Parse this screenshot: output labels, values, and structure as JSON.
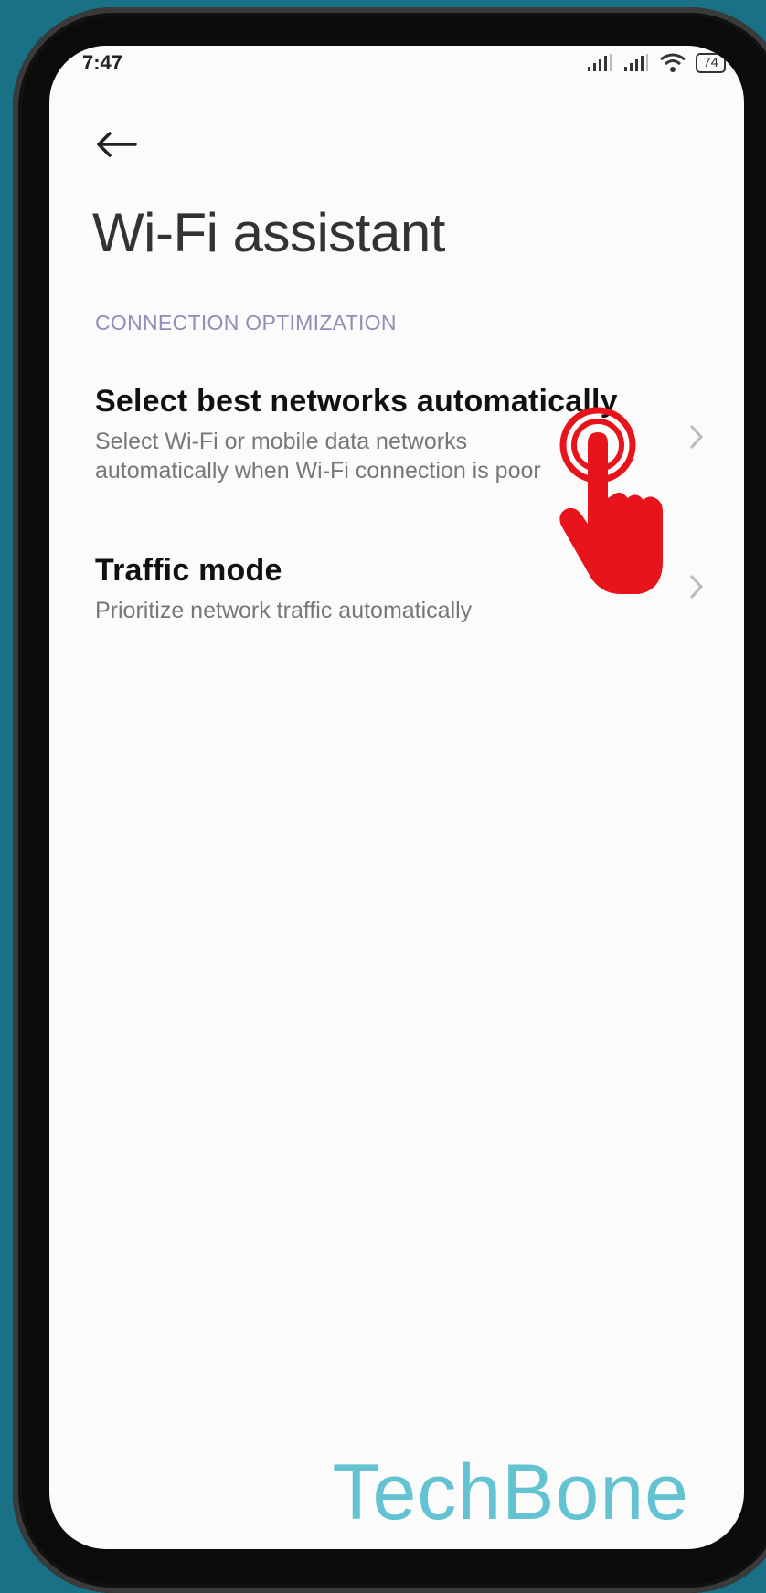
{
  "status": {
    "time": "7:47",
    "battery": "74"
  },
  "header": {
    "title": "Wi-Fi assistant"
  },
  "section": {
    "label": "CONNECTION OPTIMIZATION"
  },
  "items": [
    {
      "title": "Select best networks automatically",
      "subtitle": "Select Wi-Fi or mobile data networks automatically when Wi-Fi connection is poor"
    },
    {
      "title": "Traffic mode",
      "subtitle": "Prioritize network traffic automatically"
    }
  ],
  "watermark": "TechBone",
  "colors": {
    "background": "#1a7185",
    "section": "#8f8fb6",
    "watermark": "#63c3d3",
    "hand": "#e8141b"
  },
  "icons": [
    "signal-icon",
    "wifi-icon",
    "battery-icon",
    "back-arrow-icon",
    "chevron-right-icon",
    "tap-hand-icon"
  ]
}
